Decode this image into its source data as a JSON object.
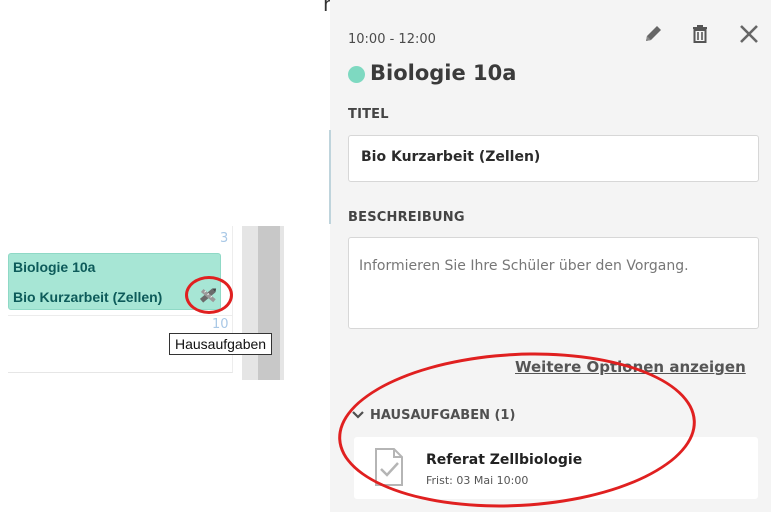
{
  "top_partial_text": "ng",
  "calendar": {
    "day_numbers": [
      "3",
      "10"
    ],
    "event": {
      "title": "Biologie 10a",
      "subtitle": "Bio Kurzarbeit (Zellen)",
      "homework_icon": "homework-pencil-ruler-icon",
      "color": "#a7e6d5"
    },
    "tooltip": "Hausaufgaben"
  },
  "panel": {
    "time": "10:00 - 12:00",
    "course": "Biologie 10a",
    "course_color": "#7ed9c1",
    "icons": [
      "pencil-icon",
      "trash-icon",
      "close-icon"
    ],
    "title_label": "TITEL",
    "title_value": "Bio Kurzarbeit (Zellen)",
    "description_label": "BESCHREIBUNG",
    "description_placeholder": "Informieren Sie Ihre Schüler über den Vorgang.",
    "more_options": "Weitere Optionen anzeigen",
    "homework_section": "HAUSAUFGABEN (1)",
    "homework_item": {
      "title": "Referat Zellbiologie",
      "deadline": "Frist: 03 Mai 10:00",
      "icon": "document-check-icon"
    }
  },
  "annotation_color": "#e02020"
}
